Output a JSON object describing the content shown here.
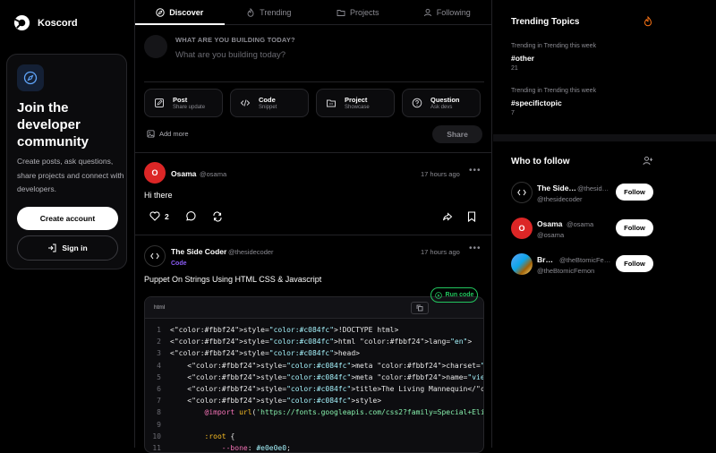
{
  "app": {
    "name": "Koscord",
    "logo_icon": "koscord-logo-icon"
  },
  "join": {
    "title": "Join the developer community",
    "description": "Create posts, ask questions, share projects and connect with developers.",
    "create_label": "Create account",
    "signin_label": "Sign in"
  },
  "tabs": [
    {
      "label": "Discover",
      "icon": "compass-icon",
      "active": true
    },
    {
      "label": "Trending",
      "icon": "flame-icon",
      "active": false
    },
    {
      "label": "Projects",
      "icon": "folder-icon",
      "active": false
    },
    {
      "label": "Following",
      "icon": "user-icon",
      "active": false
    }
  ],
  "composer": {
    "label": "WHAT ARE YOU BUILDING TODAY?",
    "placeholder": "What are you building today?",
    "types": [
      {
        "title": "Post",
        "subtitle": "Share update",
        "icon": "edit-icon"
      },
      {
        "title": "Code",
        "subtitle": "Snippet",
        "icon": "code-icon"
      },
      {
        "title": "Project",
        "subtitle": "Showcase",
        "icon": "folder-icon"
      },
      {
        "title": "Question",
        "subtitle": "Ask devs",
        "icon": "help-circle-icon"
      }
    ],
    "add_more": "Add more",
    "share": "Share"
  },
  "posts": [
    {
      "name": "Osama",
      "handle": "@osama",
      "avatar_initial": "O",
      "avatar_color": "#dc2626",
      "time": "17 hours ago",
      "text": "Hi there",
      "likes": "2"
    },
    {
      "name": "The Side Coder",
      "handle": "@thesidecoder",
      "tag": "Code",
      "time": "17 hours ago",
      "text": "Puppet On Strings Using HTML CSS & Javascript",
      "run_label": "Run code",
      "lang": "html",
      "code": [
        {
          "n": "1",
          "t": "<!DOCTYPE html>"
        },
        {
          "n": "2",
          "t": "<html lang=\"en\">"
        },
        {
          "n": "3",
          "t": "<head>"
        },
        {
          "n": "4",
          "t": "    <meta charset=\"UTF-8\">"
        },
        {
          "n": "5",
          "t": "    <meta name=\"viewport\" content=\"width=device-width, initial-scale=1.0\">"
        },
        {
          "n": "6",
          "t": "    <title>The Living Mannequin</title>"
        },
        {
          "n": "7",
          "t": "    <style>"
        },
        {
          "n": "8",
          "t": "        @import url('https://fonts.googleapis.com/css2?family=Special+Elite&family=Sp"
        },
        {
          "n": "9",
          "t": ""
        },
        {
          "n": "10",
          "t": "        :root {"
        },
        {
          "n": "11",
          "t": "            --bone: #e0e0e0;"
        }
      ]
    }
  ],
  "trending": {
    "title": "Trending Topics",
    "items": [
      {
        "sub": "Trending in Trending this week",
        "tag": "#other",
        "count": "21"
      },
      {
        "sub": "Trending in Trending this week",
        "tag": "#specifictopic",
        "count": "7"
      }
    ]
  },
  "who_to_follow": {
    "title": "Who to follow",
    "follow_label": "Follow",
    "users": [
      {
        "name": "The Side…",
        "handle_short": "@thesid…",
        "handle": "@thesidecoder"
      },
      {
        "name": "Osama",
        "handle_short": "@osama",
        "handle": "@osama",
        "initial": "O"
      },
      {
        "name": "Br…",
        "handle_short": "@theBtomicFe…",
        "handle": "@theBtomicFemon"
      }
    ]
  },
  "colors": {
    "accent_purple": "#8b5cf6",
    "run_green": "#22c55e",
    "avatar_red": "#dc2626",
    "flame_orange": "#f97316"
  }
}
